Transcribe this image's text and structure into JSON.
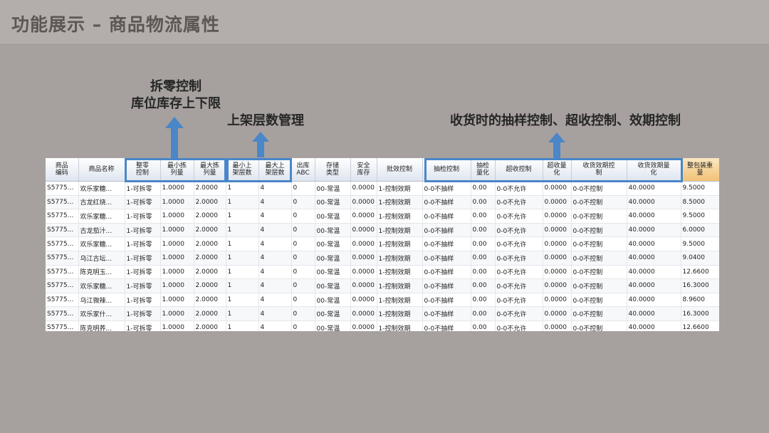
{
  "page_title": "功能展示 – 商品物流属性",
  "annotations": {
    "split_line1": "拆零控制",
    "split_line2": "库位库存上下限",
    "shelf": "上架层数管理",
    "receiving": "收货时的抽样控制、超收控制、效期控制"
  },
  "colors": {
    "highlight_border": "#4a86c8",
    "last_col_header": "#f2c277",
    "background": "#a6a19e"
  },
  "grid": {
    "headers": [
      [
        "商品",
        "编码"
      ],
      [
        "商品名称"
      ],
      [
        "整零",
        "控制"
      ],
      [
        "最小拣",
        "列量"
      ],
      [
        "最大拣",
        "列量"
      ],
      [
        "最小上",
        "架层数"
      ],
      [
        "最大上",
        "架层数"
      ],
      [
        "出库",
        "ABC"
      ],
      [
        "存储",
        "类型"
      ],
      [
        "安全",
        "库存"
      ],
      [
        "批效控制"
      ],
      [
        "抽检控制"
      ],
      [
        "抽检",
        "量化"
      ],
      [
        "超收控制"
      ],
      [
        "超收量",
        "化"
      ],
      [
        "收货效期控",
        "制"
      ],
      [
        "收货效期量",
        "化"
      ],
      [
        "整包装重",
        "量"
      ]
    ],
    "rows": [
      [
        "S5775...",
        "欢乐家糖...",
        "1-可拆零",
        "1.0000",
        "2.0000",
        "1",
        "4",
        "0",
        "00-常温",
        "0.0000",
        "1-控制效期",
        "0-0不抽样",
        "0.00",
        "0-0不允许",
        "0.0000",
        "0-0不控制",
        "40.0000",
        "9.5000"
      ],
      [
        "S5775...",
        "古龙红烧...",
        "1-可拆零",
        "1.0000",
        "2.0000",
        "1",
        "4",
        "0",
        "00-常温",
        "0.0000",
        "1-控制效期",
        "0-0不抽样",
        "0.00",
        "0-0不允许",
        "0.0000",
        "0-0不控制",
        "40.0000",
        "8.5000"
      ],
      [
        "S5775...",
        "欢乐家糖...",
        "1-可拆零",
        "1.0000",
        "2.0000",
        "1",
        "4",
        "0",
        "00-常温",
        "0.0000",
        "1-控制效期",
        "0-0不抽样",
        "0.00",
        "0-0不允许",
        "0.0000",
        "0-0不控制",
        "40.0000",
        "9.5000"
      ],
      [
        "S5775...",
        "古龙茄汁...",
        "1-可拆零",
        "1.0000",
        "2.0000",
        "1",
        "4",
        "0",
        "00-常温",
        "0.0000",
        "1-控制效期",
        "0-0不抽样",
        "0.00",
        "0-0不允许",
        "0.0000",
        "0-0不控制",
        "40.0000",
        "6.0000"
      ],
      [
        "S5775...",
        "欢乐家糖...",
        "1-可拆零",
        "1.0000",
        "2.0000",
        "1",
        "4",
        "0",
        "00-常温",
        "0.0000",
        "1-控制效期",
        "0-0不抽样",
        "0.00",
        "0-0不允许",
        "0.0000",
        "0-0不控制",
        "40.0000",
        "9.5000"
      ],
      [
        "S5775...",
        "乌江古坛...",
        "1-可拆零",
        "1.0000",
        "2.0000",
        "1",
        "4",
        "0",
        "00-常温",
        "0.0000",
        "1-控制效期",
        "0-0不抽样",
        "0.00",
        "0-0不允许",
        "0.0000",
        "0-0不控制",
        "40.0000",
        "9.0400"
      ],
      [
        "S5775...",
        "陈克明玉...",
        "1-可拆零",
        "1.0000",
        "2.0000",
        "1",
        "4",
        "0",
        "00-常温",
        "0.0000",
        "1-控制效期",
        "0-0不抽样",
        "0.00",
        "0-0不允许",
        "0.0000",
        "0-0不控制",
        "40.0000",
        "12.6600"
      ],
      [
        "S5775...",
        "欢乐家糖...",
        "1-可拆零",
        "1.0000",
        "2.0000",
        "1",
        "4",
        "0",
        "00-常温",
        "0.0000",
        "1-控制效期",
        "0-0不抽样",
        "0.00",
        "0-0不允许",
        "0.0000",
        "0-0不控制",
        "40.0000",
        "16.3000"
      ],
      [
        "S5775...",
        "乌江微辣...",
        "1-可拆零",
        "1.0000",
        "2.0000",
        "1",
        "4",
        "0",
        "00-常温",
        "0.0000",
        "1-控制效期",
        "0-0不抽样",
        "0.00",
        "0-0不允许",
        "0.0000",
        "0-0不控制",
        "40.0000",
        "8.9600"
      ],
      [
        "S5775...",
        "欢乐家什...",
        "1-可拆零",
        "1.0000",
        "2.0000",
        "1",
        "4",
        "0",
        "00-常温",
        "0.0000",
        "1-控制效期",
        "0-0不抽样",
        "0.00",
        "0-0不允许",
        "0.0000",
        "0-0不控制",
        "40.0000",
        "16.3000"
      ],
      [
        "S5775...",
        "陈克明荞...",
        "1-可拆零",
        "1.0000",
        "2.0000",
        "1",
        "4",
        "0",
        "00-常温",
        "0.0000",
        "1-控制效期",
        "0-0不抽样",
        "0.00",
        "0-0不允许",
        "0.0000",
        "0-0不控制",
        "40.0000",
        "12.6600"
      ]
    ]
  }
}
